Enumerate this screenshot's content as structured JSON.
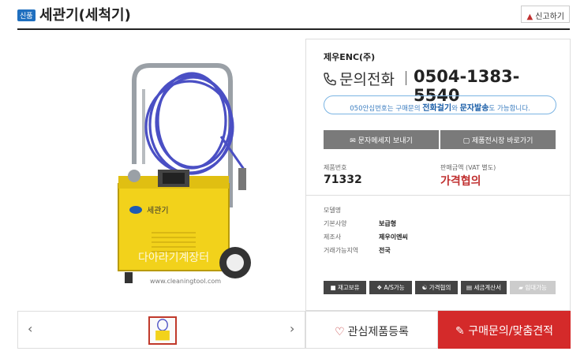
{
  "header": {
    "badge": "신품",
    "title": "세관기(세척기)",
    "report_label": "신고하기"
  },
  "gallery": {
    "prev_arrow": "‹",
    "next_arrow": "›",
    "image_caption": "세관기",
    "watermark": "다아라기계장터",
    "url_text": "www.cleaningtool.com"
  },
  "seller": {
    "company": "제우ENC(주)",
    "phone_label": "문의전화",
    "phone_number": "0504-1383-5540",
    "notice_prefix": "050안심번호는 구매문의",
    "notice_call": "전화걸기",
    "notice_mid": "와",
    "notice_sms": "문자발송",
    "notice_suffix": "도 가능합니다."
  },
  "actions": {
    "send_message": "문자메세지 보내기",
    "go_store": "제품전시장 바로가기"
  },
  "product": {
    "number_label": "제품번호",
    "number_value": "71332",
    "price_label": "판매금액 (VAT 별도)",
    "price_value": "가격협의"
  },
  "specs": [
    {
      "label": "모델명",
      "value": ""
    },
    {
      "label": "기본사양",
      "value": "보급형"
    },
    {
      "label": "제조사",
      "value": "제우이엔씨"
    },
    {
      "label": "거래가능지역",
      "value": "전국"
    }
  ],
  "chips": [
    "재고보유",
    "A/S가능",
    "가격협의",
    "세금계산서",
    "임대가능"
  ],
  "buttons": {
    "interest": "관심제품등록",
    "inquiry": "구매문의/맞춤견적"
  },
  "colors": {
    "accent_red": "#d42a2a",
    "badge_blue": "#1f6fbf",
    "notice_blue": "#3e7fc1",
    "machine_yellow": "#f2d21b"
  }
}
